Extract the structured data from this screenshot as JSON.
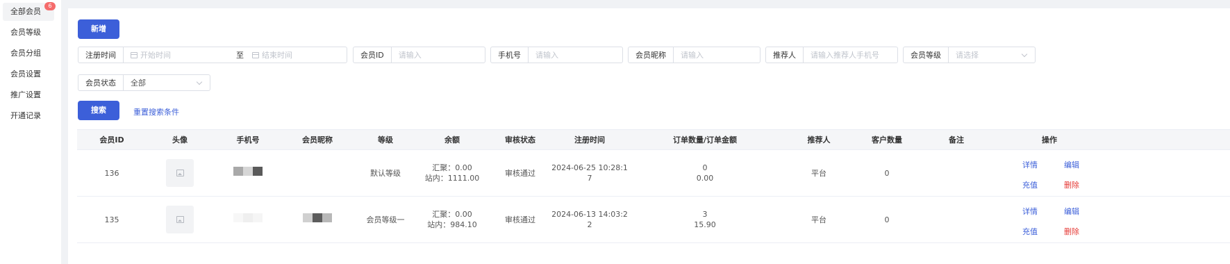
{
  "sidebar": {
    "items": [
      {
        "label": "全部会员",
        "badge": "6"
      },
      {
        "label": "会员等级"
      },
      {
        "label": "会员分组"
      },
      {
        "label": "会员设置"
      },
      {
        "label": "推广设置"
      },
      {
        "label": "开通记录"
      }
    ]
  },
  "toolbar": {
    "add_label": "新增"
  },
  "filters": {
    "reg_time": {
      "label": "注册时间",
      "start_placeholder": "开始时间",
      "separator": "至",
      "end_placeholder": "结束时间"
    },
    "member_id": {
      "label": "会员ID",
      "placeholder": "请输入"
    },
    "phone": {
      "label": "手机号",
      "placeholder": "请输入"
    },
    "nickname": {
      "label": "会员昵称",
      "placeholder": "请输入"
    },
    "referrer": {
      "label": "推荐人",
      "placeholder": "请输入推荐人手机号"
    },
    "level": {
      "label": "会员等级",
      "placeholder": "请选择"
    },
    "status": {
      "label": "会员状态",
      "value": "全部"
    },
    "search_label": "搜索",
    "reset_label": "重置搜索条件"
  },
  "table": {
    "headers": [
      "会员ID",
      "头像",
      "手机号",
      "会员昵称",
      "等级",
      "余额",
      "审核状态",
      "注册时间",
      "订单数量/订单金额",
      "推荐人",
      "客户数量",
      "备注",
      "操作"
    ],
    "rows": [
      {
        "id": "136",
        "level": "默认等级",
        "balance_1": "汇聚：0.00",
        "balance_2": "站内：1111.00",
        "status": "审核通过",
        "reg_time_1": "2024-06-25 10:28:1",
        "reg_time_2": "7",
        "orders_count": "0",
        "orders_amount": "0.00",
        "referrer": "平台",
        "customers": "0",
        "remark": "",
        "actions": {
          "detail": "详情",
          "edit": "编辑",
          "recharge": "充值",
          "delete": "删除"
        }
      },
      {
        "id": "135",
        "level": "会员等级一",
        "balance_1": "汇聚：0.00",
        "balance_2": "站内：984.10",
        "status": "审核通过",
        "reg_time_1": "2024-06-13 14:03:2",
        "reg_time_2": "2",
        "orders_count": "3",
        "orders_amount": "15.90",
        "referrer": "平台",
        "customers": "0",
        "remark": "",
        "actions": {
          "detail": "详情",
          "edit": "编辑",
          "recharge": "充值",
          "delete": "删除"
        }
      }
    ]
  },
  "colors": {
    "accent": "#3c5fd9",
    "danger": "#f56c6c",
    "delete": "#e53935"
  }
}
